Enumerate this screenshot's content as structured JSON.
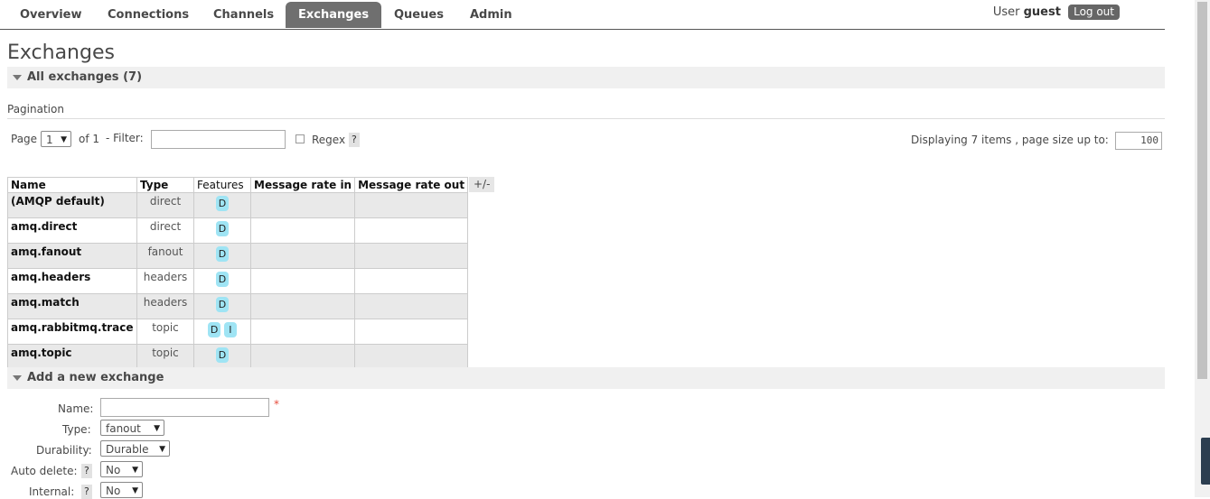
{
  "nav": {
    "tabs": [
      {
        "label": "Overview"
      },
      {
        "label": "Connections"
      },
      {
        "label": "Channels"
      },
      {
        "label": "Exchanges"
      },
      {
        "label": "Queues"
      },
      {
        "label": "Admin"
      }
    ],
    "user_label": "User",
    "user_name": "guest",
    "logout_label": "Log out"
  },
  "page_title": "Exchanges",
  "all_section": {
    "title": "All exchanges (7)"
  },
  "pagination": {
    "label": "Pagination",
    "page_label": "Page",
    "page_value": "1",
    "of_label": "of 1",
    "filter_label": "- Filter:",
    "filter_value": "",
    "regex_label": "Regex",
    "help_glyph": "?",
    "displaying_label": "Displaying 7 items , page size up to:",
    "page_size_value": "100"
  },
  "table": {
    "headers": {
      "name": "Name",
      "type": "Type",
      "features": "Features",
      "rate_in": "Message rate in",
      "rate_out": "Message rate out"
    },
    "plus_minus": "+/-",
    "rows": [
      {
        "name": "(AMQP default)",
        "type": "direct",
        "features": [
          "D"
        ]
      },
      {
        "name": "amq.direct",
        "type": "direct",
        "features": [
          "D"
        ]
      },
      {
        "name": "amq.fanout",
        "type": "fanout",
        "features": [
          "D"
        ]
      },
      {
        "name": "amq.headers",
        "type": "headers",
        "features": [
          "D"
        ]
      },
      {
        "name": "amq.match",
        "type": "headers",
        "features": [
          "D"
        ]
      },
      {
        "name": "amq.rabbitmq.trace",
        "type": "topic",
        "features": [
          "D",
          "I"
        ]
      },
      {
        "name": "amq.topic",
        "type": "topic",
        "features": [
          "D"
        ]
      }
    ]
  },
  "add_section": {
    "title": "Add a new exchange",
    "name_label": "Name:",
    "name_value": "",
    "required_mark": "*",
    "type_label": "Type:",
    "type_value": "fanout",
    "durability_label": "Durability:",
    "durability_value": "Durable",
    "auto_delete_label": "Auto delete:",
    "auto_delete_value": "No",
    "internal_label": "Internal:",
    "internal_value": "No"
  }
}
